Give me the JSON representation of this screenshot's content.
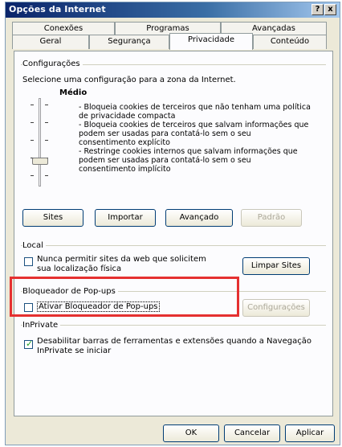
{
  "window": {
    "title": "Opções da Internet",
    "help_glyph": "?",
    "close_glyph": "x"
  },
  "tabs_back": [
    "Conexões",
    "Programas",
    "Avançadas"
  ],
  "tabs_front": [
    "Geral",
    "Segurança",
    "Privacidade",
    "Conteúdo"
  ],
  "active_tab": "Privacidade",
  "settings": {
    "group_label": "Configurações",
    "prompt": "Selecione uma configuração para a zona da Internet.",
    "level_title": "Médio",
    "description": [
      "- Bloqueia cookies de terceiros que não tenham uma política",
      "de privacidade compacta",
      "- Bloqueia cookies de terceiros que salvam informações que",
      "podem ser usadas para contatá-lo sem o seu",
      "consentimento explícito",
      "- Restringe cookies internos que salvam informações que",
      "podem ser usadas para contatá-lo sem o seu",
      "consentimento implícito"
    ],
    "slider_level": "Médio",
    "buttons": {
      "sites": "Sites",
      "import": "Importar",
      "advanced": "Avançado",
      "default": "Padrão"
    }
  },
  "location": {
    "group_label": "Local",
    "checkbox_line1": "Nunca permitir sites da web que solicitem",
    "checkbox_line2": "sua localização física",
    "checked": false,
    "clear_button": "Limpar Sites"
  },
  "popup": {
    "group_label": "Bloqueador de Pop-ups",
    "checkbox_label": "Ativar Bloqueador de Pop-ups",
    "checked": false,
    "settings_button": "Configurações"
  },
  "inprivate": {
    "group_label": "InPrivate",
    "checkbox_line1": "Desabilitar barras de ferramentas e extensões quando a Navegação",
    "checkbox_line2": "InPrivate se iniciar",
    "checked": true
  },
  "footer": {
    "ok": "OK",
    "cancel": "Cancelar",
    "apply": "Aplicar"
  },
  "colors": {
    "highlight": "#e53030",
    "title_bar": "#0a246a"
  }
}
